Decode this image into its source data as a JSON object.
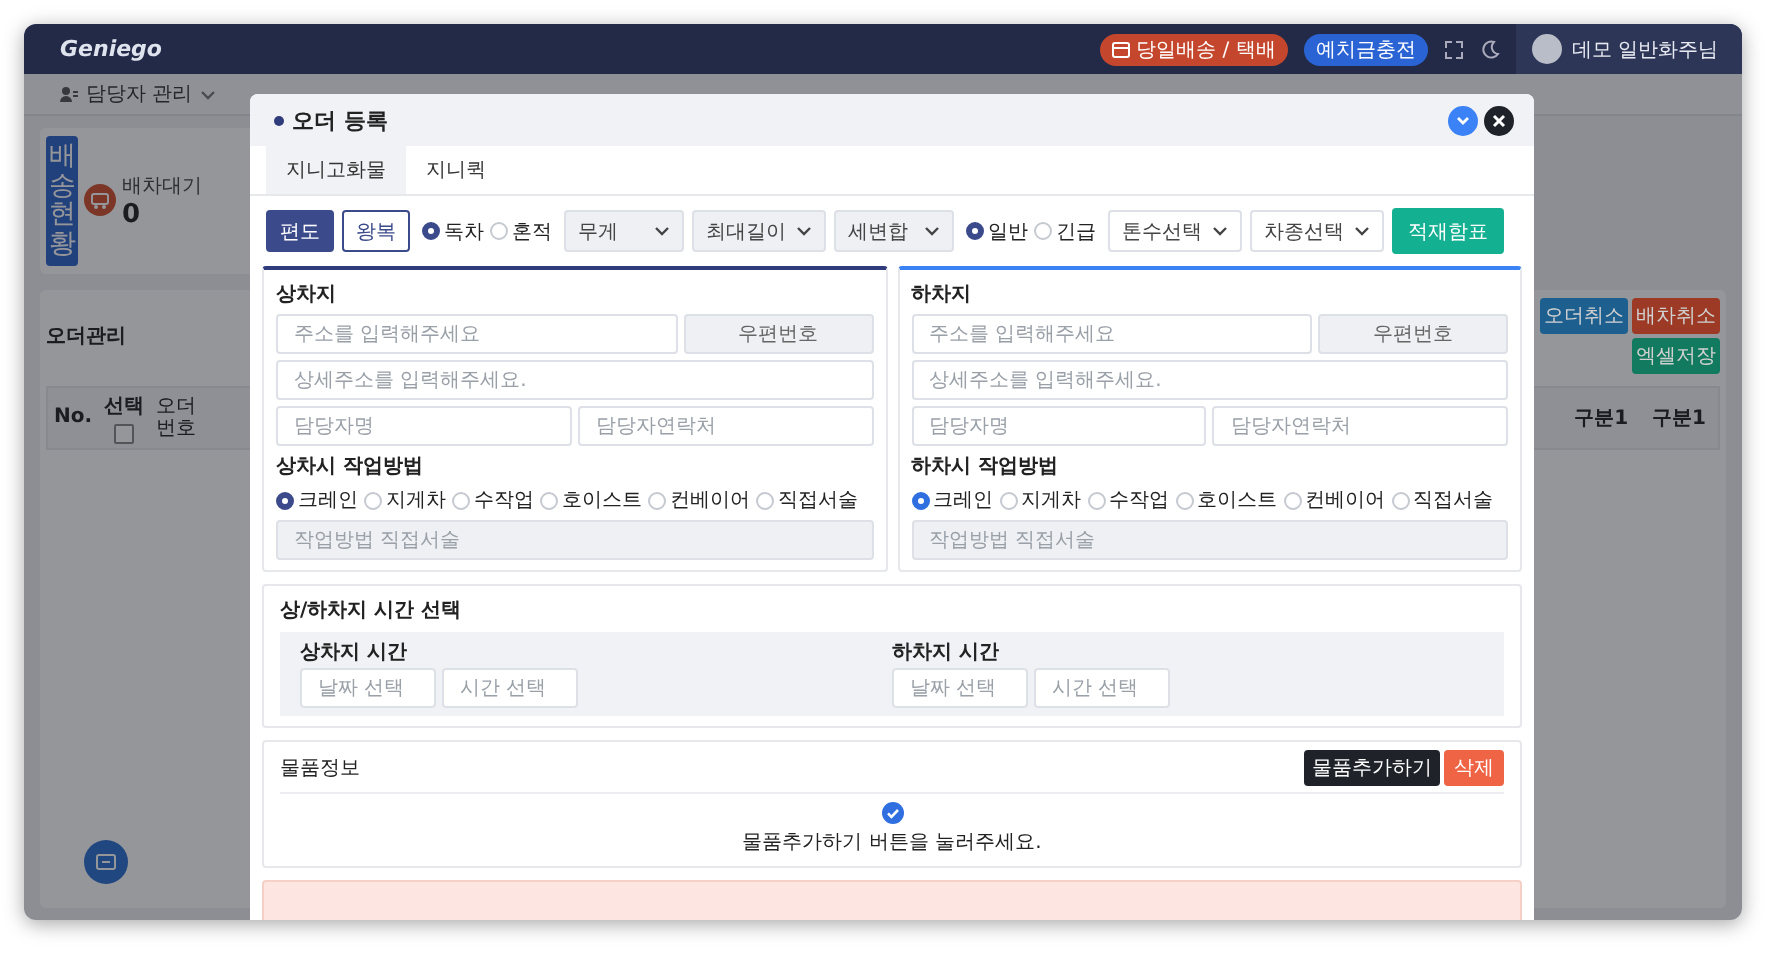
{
  "app_header": {
    "logo": "Geniego",
    "badges": [
      {
        "label": "당일배송 / 택배",
        "color": "#c4472d"
      },
      {
        "label": "예치금충전",
        "color": "#2a63d4"
      }
    ],
    "user": "데모 일반화주님"
  },
  "nav": [
    {
      "label": "담당자 관리"
    }
  ],
  "dashboard": {
    "status_button": "배송현황",
    "stat_label": "배차대기",
    "stat_value": "0"
  },
  "orders": {
    "title": "오더관리",
    "actions": [
      {
        "label": "오더취소",
        "color": "#1d5f8f"
      },
      {
        "label": "배차취소",
        "color": "#9c3a26"
      },
      {
        "label": "엑셀저장",
        "color": "#127a5f"
      }
    ],
    "columns": [
      {
        "label": "No."
      },
      {
        "label": "선택",
        "checked": false
      },
      {
        "label": "오더번호"
      },
      {
        "label": "구분1"
      },
      {
        "label": "구분1"
      }
    ]
  },
  "modal": {
    "title": "오더 등록",
    "tabs": [
      {
        "label": "지니고화물",
        "selected": true
      },
      {
        "label": "지니퀵",
        "selected": false
      }
    ],
    "trip_types": [
      {
        "label": "편도",
        "selected": true
      },
      {
        "label": "왕복",
        "selected": false
      }
    ],
    "load_types": [
      {
        "label": "독차",
        "selected": true
      },
      {
        "label": "혼적",
        "selected": false
      }
    ],
    "cargo_selects": [
      {
        "value": "무게"
      },
      {
        "value": "최대길이"
      },
      {
        "value": "세변합"
      }
    ],
    "urgency": [
      {
        "label": "일반",
        "selected": true
      },
      {
        "label": "긴급",
        "selected": false
      }
    ],
    "vehicle_selects": [
      {
        "value": "톤수선택"
      },
      {
        "value": "차종선택"
      }
    ],
    "load_chart_button": "적재함표",
    "locations": [
      {
        "title": "상차지",
        "color": "#2f3b7a",
        "address_placeholder": "주소를 입력해주세요",
        "zip_button": "우편번호",
        "detail_placeholder": "상세주소를 입력해주세요.",
        "name_placeholder": "담당자명",
        "phone_placeholder": "담당자연락처",
        "method_title": "상차시 작업방법",
        "methods": [
          {
            "label": "크레인",
            "selected": true
          },
          {
            "label": "지게차",
            "selected": false
          },
          {
            "label": "수작업",
            "selected": false
          },
          {
            "label": "호이스트",
            "selected": false
          },
          {
            "label": "컨베이어",
            "selected": false
          },
          {
            "label": "직접서술",
            "selected": false
          }
        ],
        "method_placeholder": "작업방법 직접서술"
      },
      {
        "title": "하차지",
        "color": "#3b82f6",
        "address_placeholder": "주소를 입력해주세요",
        "zip_button": "우편번호",
        "detail_placeholder": "상세주소를 입력해주세요.",
        "name_placeholder": "담당자명",
        "phone_placeholder": "담당자연락처",
        "method_title": "하차시 작업방법",
        "methods": [
          {
            "label": "크레인",
            "selected": true
          },
          {
            "label": "지게차",
            "selected": false
          },
          {
            "label": "수작업",
            "selected": false
          },
          {
            "label": "호이스트",
            "selected": false
          },
          {
            "label": "컨베이어",
            "selected": false
          },
          {
            "label": "직접서술",
            "selected": false
          }
        ],
        "method_placeholder": "작업방법 직접서술"
      }
    ],
    "time_section": {
      "title": "상/하차지 시간 선택",
      "groups": [
        {
          "label": "상차지 시간",
          "date_placeholder": "날짜 선택",
          "time_placeholder": "시간 선택"
        },
        {
          "label": "하차지 시간",
          "date_placeholder": "날짜 선택",
          "time_placeholder": "시간 선택"
        }
      ]
    },
    "goods": {
      "title": "물품정보",
      "add_button": "물품추가하기",
      "delete_button": "삭제",
      "empty_message": "물품추가하기 버튼을 눌러주세요."
    }
  }
}
